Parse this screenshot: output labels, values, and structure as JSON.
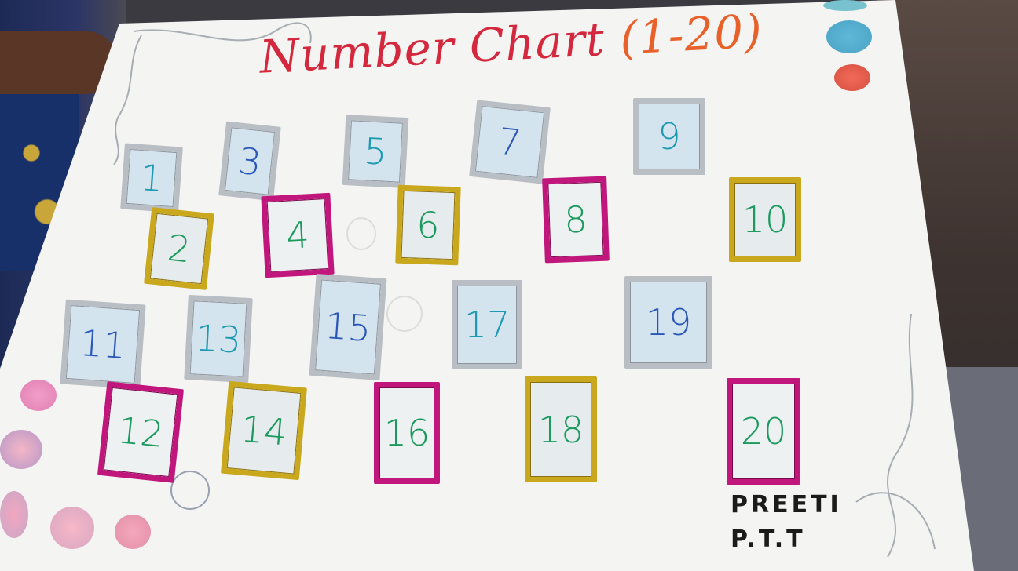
{
  "title": {
    "main": "Number Chart",
    "range": "(1-20)"
  },
  "cards": [
    {
      "value": "1",
      "frame": "silver",
      "ink": "teal"
    },
    {
      "value": "2",
      "frame": "gold",
      "ink": "green"
    },
    {
      "value": "3",
      "frame": "silver",
      "ink": "blue"
    },
    {
      "value": "4",
      "frame": "pink",
      "ink": "green"
    },
    {
      "value": "5",
      "frame": "silver",
      "ink": "teal"
    },
    {
      "value": "6",
      "frame": "gold",
      "ink": "green"
    },
    {
      "value": "7",
      "frame": "silver",
      "ink": "blue"
    },
    {
      "value": "8",
      "frame": "pink",
      "ink": "green"
    },
    {
      "value": "9",
      "frame": "silver",
      "ink": "teal"
    },
    {
      "value": "10",
      "frame": "gold",
      "ink": "green"
    },
    {
      "value": "11",
      "frame": "silver",
      "ink": "blue"
    },
    {
      "value": "12",
      "frame": "pink",
      "ink": "green"
    },
    {
      "value": "13",
      "frame": "silver",
      "ink": "teal"
    },
    {
      "value": "14",
      "frame": "gold",
      "ink": "green"
    },
    {
      "value": "15",
      "frame": "silver",
      "ink": "blue"
    },
    {
      "value": "16",
      "frame": "pink",
      "ink": "green"
    },
    {
      "value": "17",
      "frame": "silver",
      "ink": "teal"
    },
    {
      "value": "18",
      "frame": "gold",
      "ink": "green"
    },
    {
      "value": "19",
      "frame": "silver",
      "ink": "blue"
    },
    {
      "value": "20",
      "frame": "pink",
      "ink": "green"
    }
  ],
  "signature": {
    "name": "PREETI",
    "role": "P.T.T"
  },
  "colors": {
    "title": "#d3283e",
    "title_range": "#e8602a",
    "silver": "#b9bec4",
    "gold": "#c9a81e",
    "pink": "#c1177d"
  }
}
